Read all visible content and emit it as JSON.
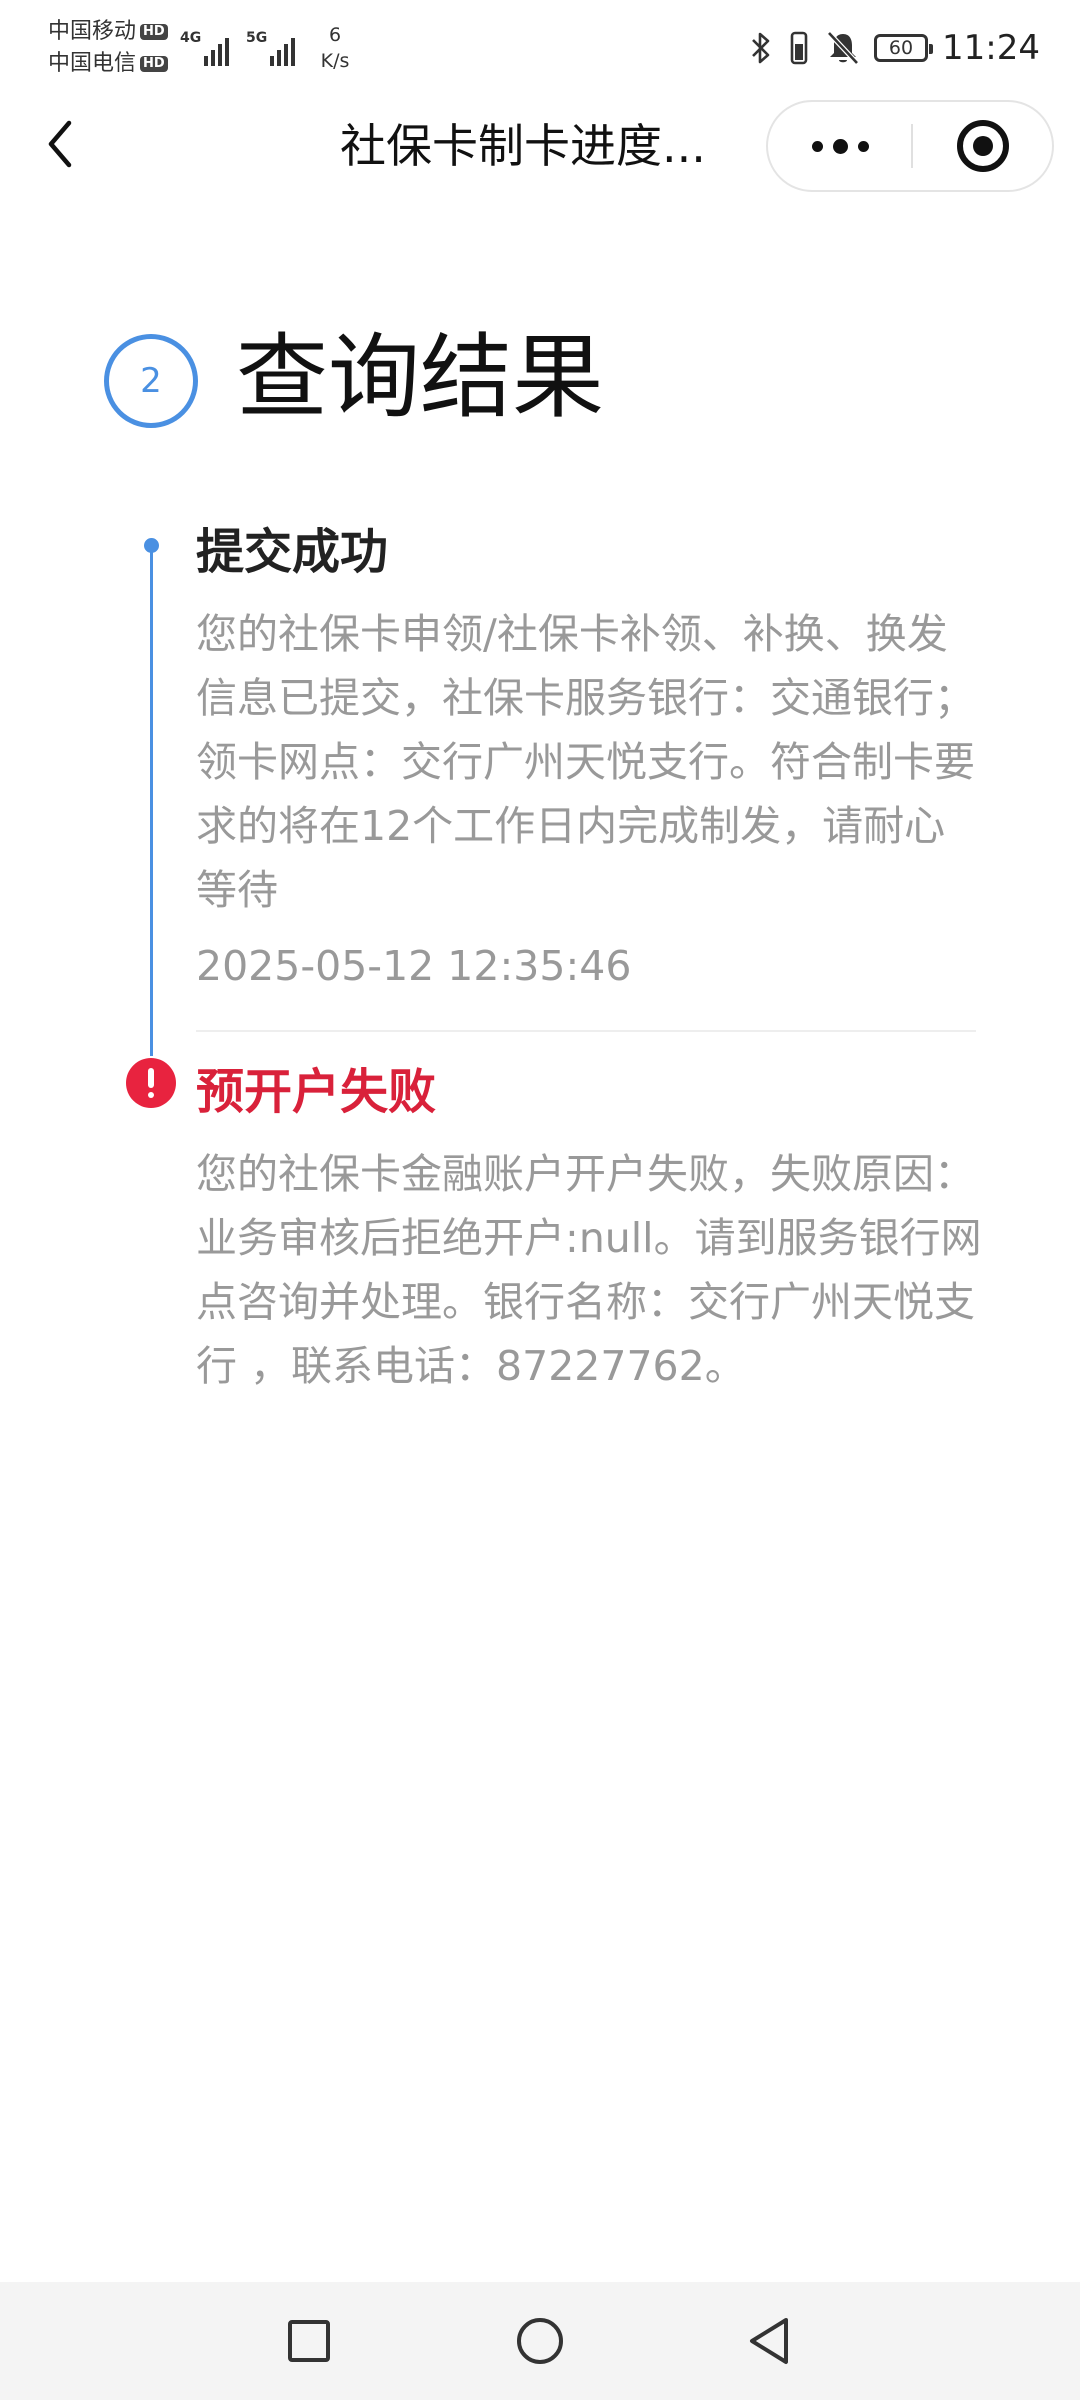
{
  "status_bar": {
    "carriers": [
      {
        "name": "中国移动",
        "badge": "HD"
      },
      {
        "name": "中国电信",
        "badge": "HD"
      }
    ],
    "network_1": "4G",
    "network_2": "5G",
    "speed_value": "6",
    "speed_unit": "K/s",
    "battery": "60",
    "time": "11:24",
    "icons": [
      "bluetooth-icon",
      "vibrate-icon",
      "mute-bell-icon",
      "battery-icon"
    ]
  },
  "nav": {
    "title": "社保卡制卡进度...",
    "back_icon": "chevron-left-icon",
    "more_icon": "more-dots-icon",
    "close_icon": "target-close-icon"
  },
  "section": {
    "step": "2",
    "title": "查询结果"
  },
  "timeline": [
    {
      "status": "success",
      "title": "提交成功",
      "description": "您的社保卡申领/社保卡补领、补换、换发信息已提交，社保卡服务银行：交通银行；领卡网点：交行广州天悦支行。符合制卡要求的将在12个工作日内完成制发，请耐心等待",
      "time": "2025-05-12 12:35:46"
    },
    {
      "status": "error",
      "title": "预开户失败",
      "description": "您的社保卡金融账户开户失败，失败原因：业务审核后拒绝开户:null。请到服务银行网点咨询并处理。银行名称：交行广州天悦支行 ，联系电话：87227762。"
    }
  ],
  "colors": {
    "accent": "#4a90e2",
    "error": "#e8233f",
    "error_text": "#d9213a",
    "muted_text": "#999999"
  },
  "system_nav": [
    "recent-apps-square-icon",
    "home-circle-icon",
    "back-triangle-icon"
  ]
}
